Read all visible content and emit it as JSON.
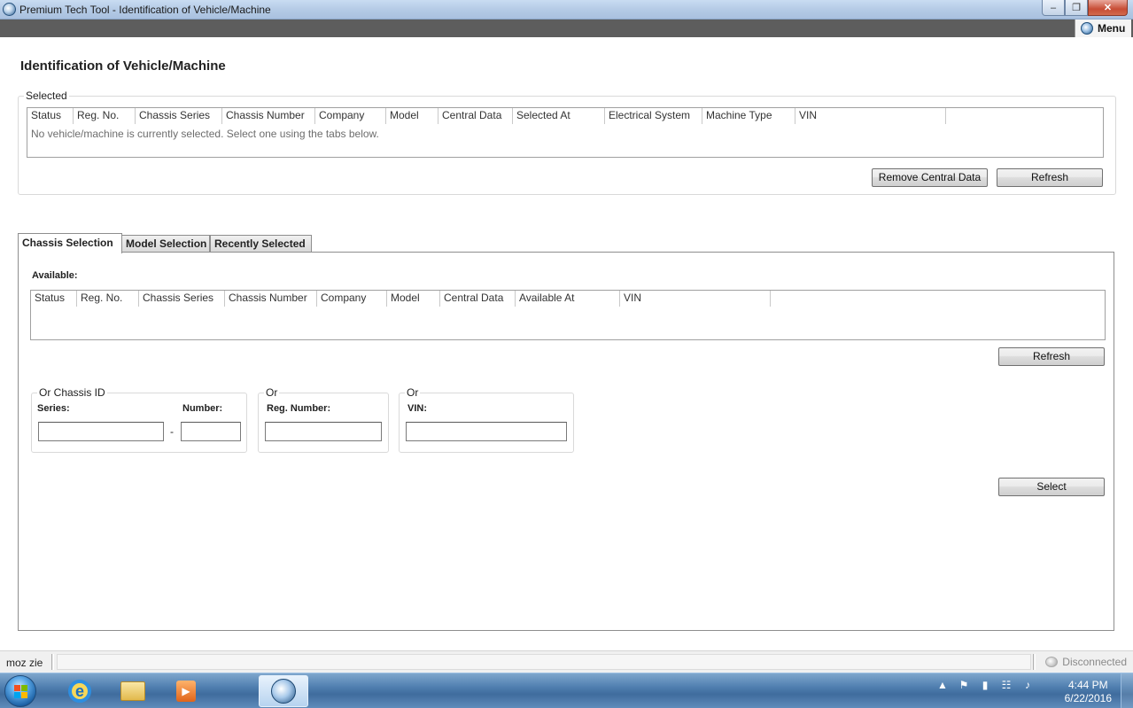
{
  "window": {
    "title": "Premium Tech Tool - Identification of Vehicle/Machine",
    "minimize_glyph": "–",
    "maximize_glyph": "❐",
    "close_glyph": "✕"
  },
  "toolbar": {
    "menu_label": "Menu"
  },
  "page": {
    "title": "Identification of Vehicle/Machine"
  },
  "selected": {
    "legend": "Selected",
    "columns": [
      "Status",
      "Reg. No.",
      "Chassis Series",
      "Chassis Number",
      "Company",
      "Model",
      "Central Data",
      "Selected At",
      "Electrical System",
      "Machine Type",
      "VIN",
      ""
    ],
    "empty_message": "No vehicle/machine is currently selected. Select one using the tabs below.",
    "remove_button": "Remove Central Data",
    "refresh_button": "Refresh"
  },
  "tabs": [
    {
      "label": "Chassis Selection",
      "active": true
    },
    {
      "label": "Model Selection",
      "active": false
    },
    {
      "label": "Recently Selected",
      "active": false
    }
  ],
  "available": {
    "label": "Available:",
    "columns": [
      "Status",
      "Reg. No.",
      "Chassis Series",
      "Chassis Number",
      "Company",
      "Model",
      "Central Data",
      "Available At",
      "VIN",
      ""
    ],
    "refresh_button": "Refresh"
  },
  "chassis_id": {
    "legend": "Or Chassis ID",
    "series_label": "Series:",
    "series_value": "",
    "dash": "-",
    "number_label": "Number:",
    "number_value": ""
  },
  "reg_number": {
    "legend": "Or",
    "label": "Reg. Number:",
    "value": ""
  },
  "vin": {
    "legend": "Or",
    "label": "VIN:",
    "value": ""
  },
  "select_button": "Select",
  "statusbar": {
    "user": "moz zie",
    "connection": "Disconnected"
  },
  "taskbar": {
    "time": "4:44 PM",
    "date": "6/22/2016",
    "ie_letter": "e",
    "media_glyph": "▶",
    "tray_arrow": "▲",
    "tray_flag": "⚑",
    "tray_battery": "▮",
    "tray_network": "☷",
    "tray_volume": "♪"
  }
}
